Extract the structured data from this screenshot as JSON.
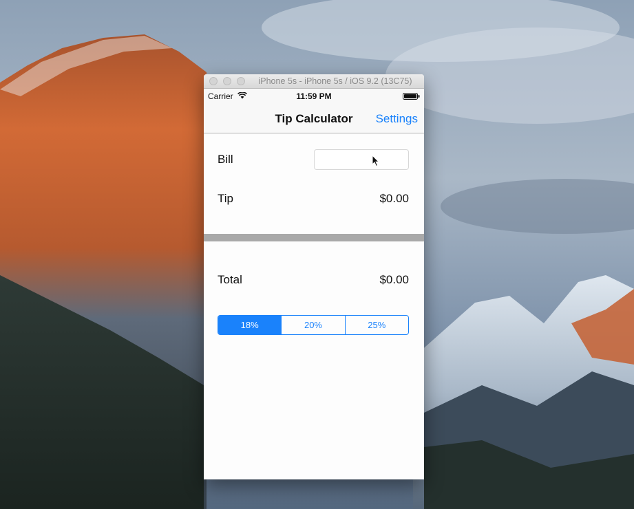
{
  "window": {
    "title": "iPhone 5s - iPhone 5s / iOS 9.2 (13C75)"
  },
  "status_bar": {
    "carrier": "Carrier",
    "time": "11:59 PM",
    "icons": [
      "wifi-icon",
      "battery-icon"
    ]
  },
  "nav_bar": {
    "title": "Tip Calculator",
    "settings_label": "Settings"
  },
  "form": {
    "bill_label": "Bill",
    "bill_value": "",
    "tip_label": "Tip",
    "tip_value": "$0.00",
    "total_label": "Total",
    "total_value": "$0.00"
  },
  "tip_segments": [
    {
      "label": "18%",
      "selected": true
    },
    {
      "label": "20%",
      "selected": false
    },
    {
      "label": "25%",
      "selected": false
    }
  ],
  "colors": {
    "accent": "#1a82fb",
    "separator": "#a9a9a9"
  }
}
